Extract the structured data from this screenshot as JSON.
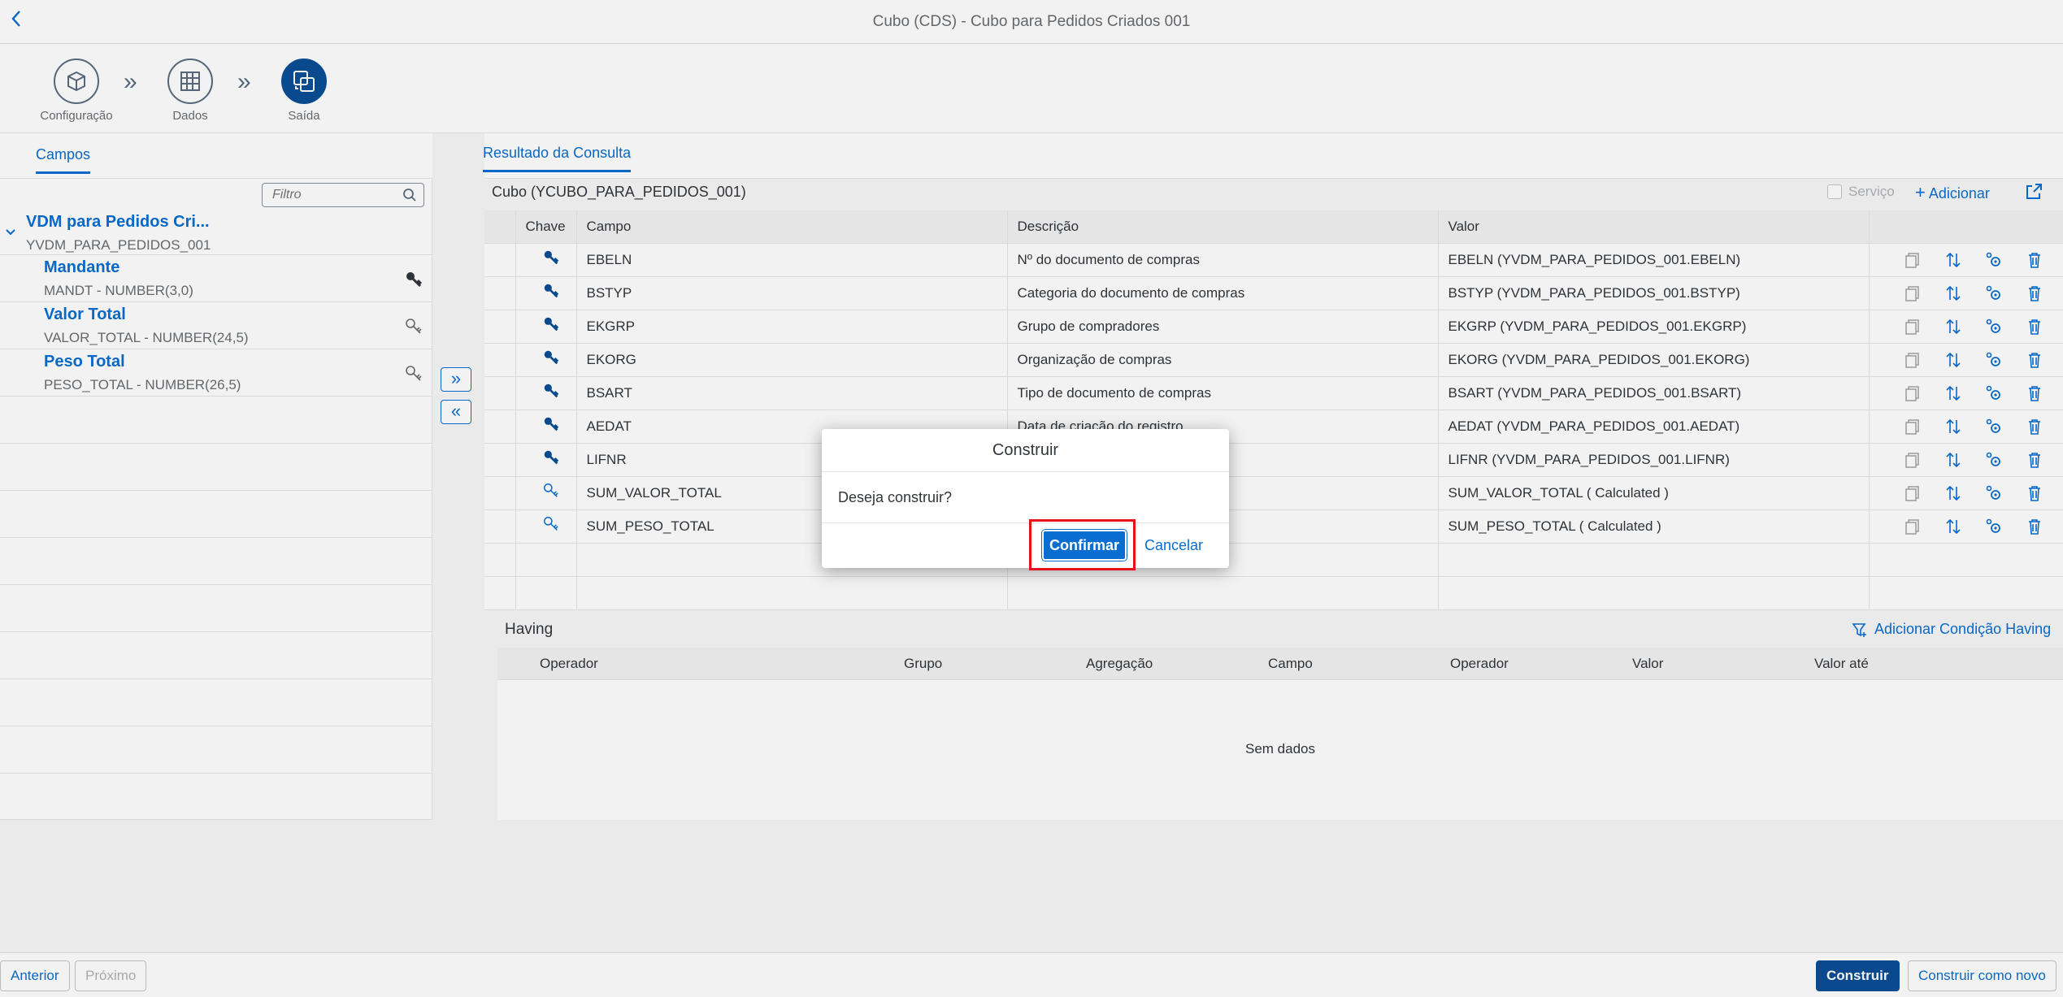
{
  "shell": {
    "title": "Cubo (CDS) - Cubo para Pedidos Criados 001"
  },
  "wizard": {
    "steps": [
      {
        "label": "Configuração"
      },
      {
        "label": "Dados"
      },
      {
        "label": "Saída"
      }
    ]
  },
  "left": {
    "tab": "Campos",
    "filter_placeholder": "Filtro",
    "source": {
      "name": "VDM para Pedidos Cri...",
      "id": "YVDM_PARA_PEDIDOS_001"
    },
    "fields": [
      {
        "name": "Mandante",
        "type": "MANDT - NUMBER(3,0)"
      },
      {
        "name": "Valor Total",
        "type": "VALOR_TOTAL - NUMBER(24,5)"
      },
      {
        "name": "Peso Total",
        "type": "PESO_TOTAL - NUMBER(26,5)"
      }
    ]
  },
  "right": {
    "tab": "Resultado da Consulta",
    "cube_title": "Cubo (YCUBO_PARA_PEDIDOS_001)",
    "servico_label": "Serviço",
    "add_label": "Adicionar",
    "columns": [
      "Chave",
      "Campo",
      "Descrição",
      "Valor"
    ],
    "rows": [
      {
        "campo": "EBELN",
        "descricao": "Nº do documento de compras",
        "valor": "EBELN (YVDM_PARA_PEDIDOS_001.EBELN)"
      },
      {
        "campo": "BSTYP",
        "descricao": "Categoria do documento de compras",
        "valor": "BSTYP (YVDM_PARA_PEDIDOS_001.BSTYP)"
      },
      {
        "campo": "EKGRP",
        "descricao": "Grupo de compradores",
        "valor": "EKGRP (YVDM_PARA_PEDIDOS_001.EKGRP)"
      },
      {
        "campo": "EKORG",
        "descricao": "Organização de compras",
        "valor": "EKORG (YVDM_PARA_PEDIDOS_001.EKORG)"
      },
      {
        "campo": "BSART",
        "descricao": "Tipo de documento de compras",
        "valor": "BSART (YVDM_PARA_PEDIDOS_001.BSART)"
      },
      {
        "campo": "AEDAT",
        "descricao": "Data de criação do registro",
        "valor": "AEDAT (YVDM_PARA_PEDIDOS_001.AEDAT)"
      },
      {
        "campo": "LIFNR",
        "descricao": "",
        "valor": "LIFNR (YVDM_PARA_PEDIDOS_001.LIFNR)"
      },
      {
        "campo": "SUM_VALOR_TOTAL",
        "descricao": "",
        "valor": "SUM_VALOR_TOTAL ( Calculated )"
      },
      {
        "campo": "SUM_PESO_TOTAL",
        "descricao": "",
        "valor": "SUM_PESO_TOTAL ( Calculated )"
      }
    ]
  },
  "having": {
    "title": "Having",
    "add_label": "Adicionar Condição Having",
    "columns": [
      "Operador",
      "Grupo",
      "Agregação",
      "Campo",
      "Operador",
      "Valor",
      "Valor até"
    ],
    "no_data": "Sem dados"
  },
  "footer": {
    "anterior": "Anterior",
    "proximo": "Próximo",
    "construir": "Construir",
    "construir_novo": "Construir como novo"
  },
  "dialog": {
    "title": "Construir",
    "message": "Deseja construir?",
    "confirm": "Confirmar",
    "cancel": "Cancelar"
  },
  "colors": {
    "accent": "#0a6ed1",
    "primary": "#0a4f96",
    "highlight": "#e8101d"
  }
}
